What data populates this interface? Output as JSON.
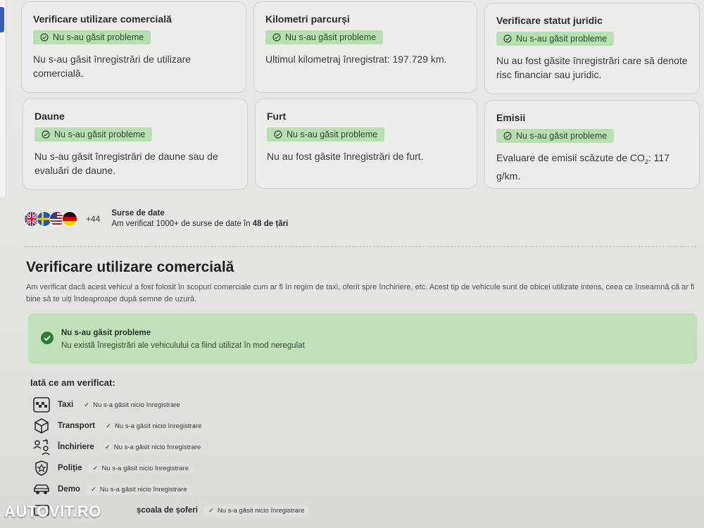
{
  "cards": [
    {
      "title": "Verificare utilizare comercială",
      "badge": "Nu s-au găsit probleme",
      "text": "Nu s-au găsit înregistrări de utilizare comercială."
    },
    {
      "title": "Kilometri parcurși",
      "badge": "Nu s-au găsit probleme",
      "text": "Ultimul kilometraj înregistrat: 197.729 km."
    },
    {
      "title": "Verificare statut juridic",
      "badge": "Nu s-au găsit probleme",
      "text": "Nu au fost găsite înregistrări care să denote risc financiar sau juridic."
    },
    {
      "title": "Daune",
      "badge": "Nu s-au găsit probleme",
      "text": "Nu s-au găsit înregistrări de daune sau de evaluări de daune."
    },
    {
      "title": "Furt",
      "badge": "Nu s-au găsit probleme",
      "text": "Nu au fost găsite înregistrări de furt."
    },
    {
      "title": "Emisii",
      "badge": "Nu s-au găsit probleme",
      "text_before": "Evaluare de emisii scăzute de CO",
      "text_sub": "2",
      "text_after": ": 117 g/km."
    }
  ],
  "sources": {
    "count": "+44",
    "title": "Surse de date",
    "text_before": "Am verificat 1000+ de surse de date în ",
    "text_bold": "48 de țări"
  },
  "section": {
    "title": "Verificare utilizare comercială",
    "description": "Am verificat dacă acest vehicul a fost folosit în scopuri comerciale cum ar fi în regim de taxi, oferit spre închiriere, etc. Acest tip de vehicule sunt de obicei utilizate intens, ceea ce înseamnă că ar fi bine să te uiți îndeaproape după semne de uzură."
  },
  "result": {
    "title": "Nu s-au găsit probleme",
    "text": "Nu există înregistrări ale vehiculului ca fiind utilizat în mod neregulat"
  },
  "checked": {
    "title": "Iată ce am verificat:",
    "items": [
      {
        "label": "Taxi",
        "status": "Nu s-a găsit nicio înregistrare",
        "icon": "taxi-icon"
      },
      {
        "label": "Transport",
        "status": "Nu s-a găsit nicio înregistrare",
        "icon": "box-icon"
      },
      {
        "label": "Închiriere",
        "status": "Nu s-a găsit nicio înregistrare",
        "icon": "rental-icon"
      },
      {
        "label": "Poliție",
        "status": "Nu s-a găsit nicio înregistrare",
        "icon": "police-badge-icon"
      },
      {
        "label": "Demo",
        "status": "Nu s-a găsit nicio înregistrare",
        "icon": "car-icon"
      },
      {
        "label": "școala de șoferi",
        "status": "Nu s-a găsit nicio înregistrare",
        "icon": "driving-school-icon"
      }
    ]
  },
  "watermark": "AUTOVIT.RO",
  "colors": {
    "badge_bg": "#b8dfb1",
    "result_bg": "#bfe0b8",
    "check_green": "#2e7d32"
  }
}
